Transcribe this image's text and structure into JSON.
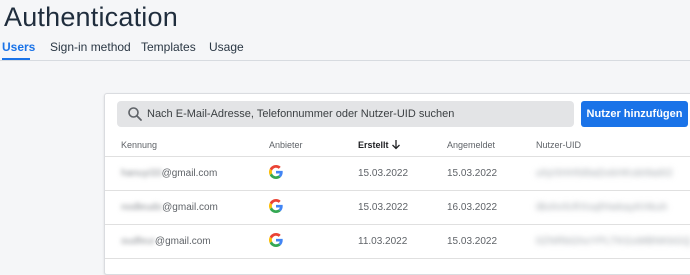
{
  "page": {
    "title": "Authentication"
  },
  "tabs": [
    {
      "label": "Users",
      "active": true
    },
    {
      "label": "Sign-in method",
      "active": false
    },
    {
      "label": "Templates",
      "active": false
    },
    {
      "label": "Usage",
      "active": false
    }
  ],
  "toolbar": {
    "search_placeholder": "Nach E-Mail-Adresse, Telefonnummer oder Nutzer-UID suchen",
    "add_user_label": "Nutzer hinzufügen"
  },
  "table": {
    "columns": [
      "Kennung",
      "Anbieter",
      "Erstellt",
      "Angemeldet",
      "Nutzer-UID"
    ],
    "sorted_column": "Erstellt",
    "rows": [
      {
        "email_local": "hanuyi33",
        "email_domain": "@gmail.com",
        "provider": "google-icon",
        "created": "15.03.2022",
        "signed_in": "15.03.2022",
        "uid": "uhjr0HHfd9aDxkHKsbt9a6l2"
      },
      {
        "email_local": "nodleudo",
        "email_domain": "@gmail.com",
        "provider": "google-icon",
        "created": "15.03.2022",
        "signed_in": "16.03.2022",
        "uid": "iBohnfcRXsqfHwkayKHkuh"
      },
      {
        "email_local": "oudfeur",
        "email_domain": "@gmail.com",
        "provider": "google-icon",
        "created": "11.03.2022",
        "signed_in": "15.03.2022",
        "uid": "0ZNRbGhoYPLTKGsMBNKbGQ"
      }
    ]
  },
  "colors": {
    "accent": "#1a73e8",
    "background": "#f5f6f8",
    "card": "#ffffff"
  }
}
